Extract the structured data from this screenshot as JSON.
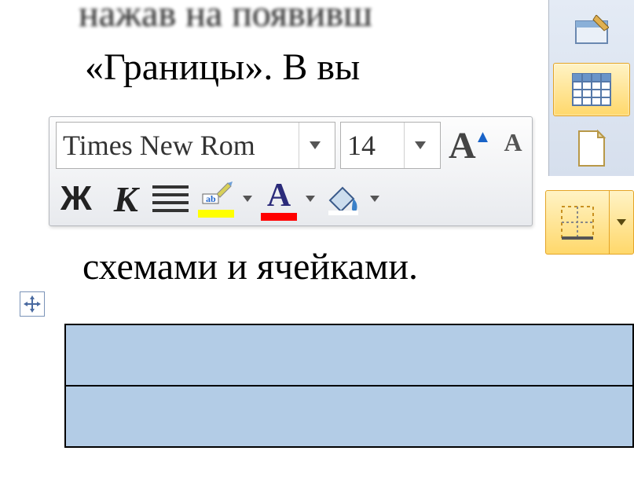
{
  "document": {
    "line1": "нажав на появивш",
    "line2": "«Границы».  В  вы",
    "line3": "схемами и ячейками."
  },
  "mini_toolbar": {
    "font_name": "Times New Rom",
    "font_size": "14",
    "bold_label": "Ж",
    "italic_label": "К",
    "font_color": "#ff0000",
    "highlight_color": "#ffff00"
  },
  "right_panel": {
    "items": [
      {
        "name": "draw-table-icon"
      },
      {
        "name": "table-grid-icon",
        "active": true
      },
      {
        "name": "blank-page-icon"
      }
    ]
  },
  "colors": {
    "selection": "#b3cce6",
    "ribbon_hover_start": "#fff3c5",
    "ribbon_hover_end": "#ffd86b"
  }
}
